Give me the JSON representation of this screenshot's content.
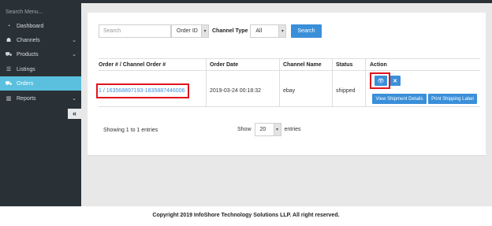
{
  "sidebar": {
    "search_placeholder": "Search Menu...",
    "items": [
      {
        "label": "Dashboard",
        "icon": "dashboard-icon",
        "glyph": "◔",
        "has_chevron": false,
        "active": false
      },
      {
        "label": "Channels",
        "icon": "users-icon",
        "glyph": "☗",
        "has_chevron": true,
        "active": false
      },
      {
        "label": "Products",
        "icon": "cart-icon",
        "glyph": "⛟",
        "has_chevron": true,
        "active": false
      },
      {
        "label": "Listings",
        "icon": "list-icon",
        "glyph": "☰",
        "has_chevron": false,
        "active": false
      },
      {
        "label": "Orders",
        "icon": "cart-icon",
        "glyph": "⛟",
        "has_chevron": false,
        "active": true
      },
      {
        "label": "Reports",
        "icon": "bar-chart-icon",
        "glyph": "▥",
        "has_chevron": true,
        "active": false
      }
    ],
    "chevron_glyph": "⌄",
    "collapse_glyph": "«"
  },
  "filters": {
    "search_placeholder": "Search",
    "order_id_select": "Order ID",
    "channel_type_label": "Channel Type",
    "channel_select": "All",
    "search_button": "Search",
    "dropdown_glyph": "▾"
  },
  "table": {
    "headers": [
      "Order # / Channel Order #",
      "Order Date",
      "Channel Name",
      "Status",
      "Action"
    ],
    "rows": [
      {
        "order": "1 / 163568897193-1835887446006",
        "date": "2019-03-24 00:18:32",
        "channel": "ebay",
        "status": "shipped",
        "view_glyph": "👁",
        "delete_glyph": "✕",
        "view_shipment_label": "View Shipment Details",
        "print_label": "Print Shipping Label"
      }
    ]
  },
  "pagination": {
    "showing_text": "Showing 1 to 1 entries",
    "show_label": "Show",
    "page_size": "20",
    "entries_label": "entries"
  },
  "footer": {
    "copyright": "Copyright 2019 InfoShore Technology Solutions LLP. All right reserved."
  },
  "colors": {
    "sidebar_bg": "#2a3136",
    "active_item": "#5bc0de",
    "primary_button": "#3a8fd9",
    "highlight_box": "#e0141e"
  }
}
